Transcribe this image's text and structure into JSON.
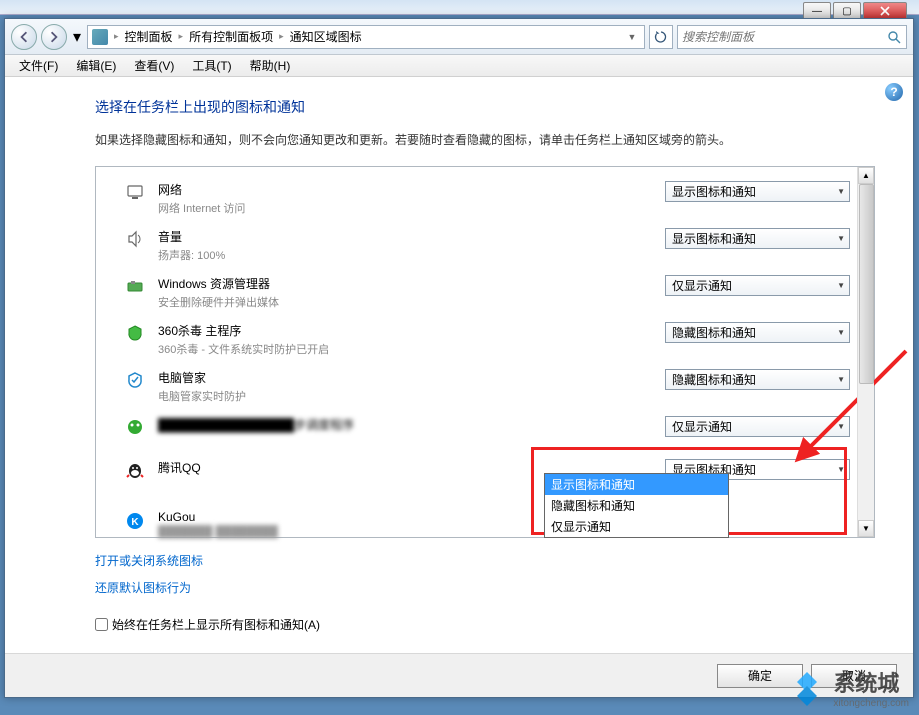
{
  "titlebar": {
    "minimize": "—",
    "maximize": "□",
    "close": "×"
  },
  "breadcrumb": {
    "items": [
      "控制面板",
      "所有控制面板项",
      "通知区域图标"
    ]
  },
  "search": {
    "placeholder": "搜索控制面板"
  },
  "menus": [
    "文件(F)",
    "编辑(E)",
    "查看(V)",
    "工具(T)",
    "帮助(H)"
  ],
  "page": {
    "title": "选择在任务栏上出现的图标和通知",
    "desc": "如果选择隐藏图标和通知，则不会向您通知更改和更新。若要随时查看隐藏的图标，请单击任务栏上通知区域旁的箭头。"
  },
  "options": {
    "show_all": "显示图标和通知",
    "hide": "隐藏图标和通知",
    "notify_only": "仅显示通知"
  },
  "rows": [
    {
      "title": "网络",
      "sub": "网络 Internet 访问",
      "value": "显示图标和通知"
    },
    {
      "title": "音量",
      "sub": "扬声器: 100%",
      "value": "显示图标和通知"
    },
    {
      "title": "Windows 资源管理器",
      "sub": "安全删除硬件并弹出媒体",
      "value": "仅显示通知"
    },
    {
      "title": "360杀毒 主程序",
      "sub": "360杀毒 - 文件系统实时防护已开启",
      "value": "隐藏图标和通知"
    },
    {
      "title": "电脑管家",
      "sub": "电脑管家实时防护",
      "value": "隐藏图标和通知"
    },
    {
      "title": "████████████████步调度程序",
      "sub": "",
      "value": "仅显示通知",
      "blur_title": true
    },
    {
      "title": "腾讯QQ",
      "sub": "",
      "value": "显示图标和通知",
      "open": true
    },
    {
      "title": "KuGou",
      "sub": "███████ ████████",
      "value": "",
      "blur_sub": true
    }
  ],
  "dropdown_items": [
    "显示图标和通知",
    "隐藏图标和通知",
    "仅显示通知"
  ],
  "links": {
    "toggle_system": "打开或关闭系统图标",
    "restore_default": "还原默认图标行为"
  },
  "checkbox": {
    "label": "始终在任务栏上显示所有图标和通知(A)"
  },
  "buttons": {
    "ok": "确定",
    "cancel": "取消"
  },
  "watermark": {
    "brand": "系统城",
    "url": "xitongcheng.com"
  }
}
